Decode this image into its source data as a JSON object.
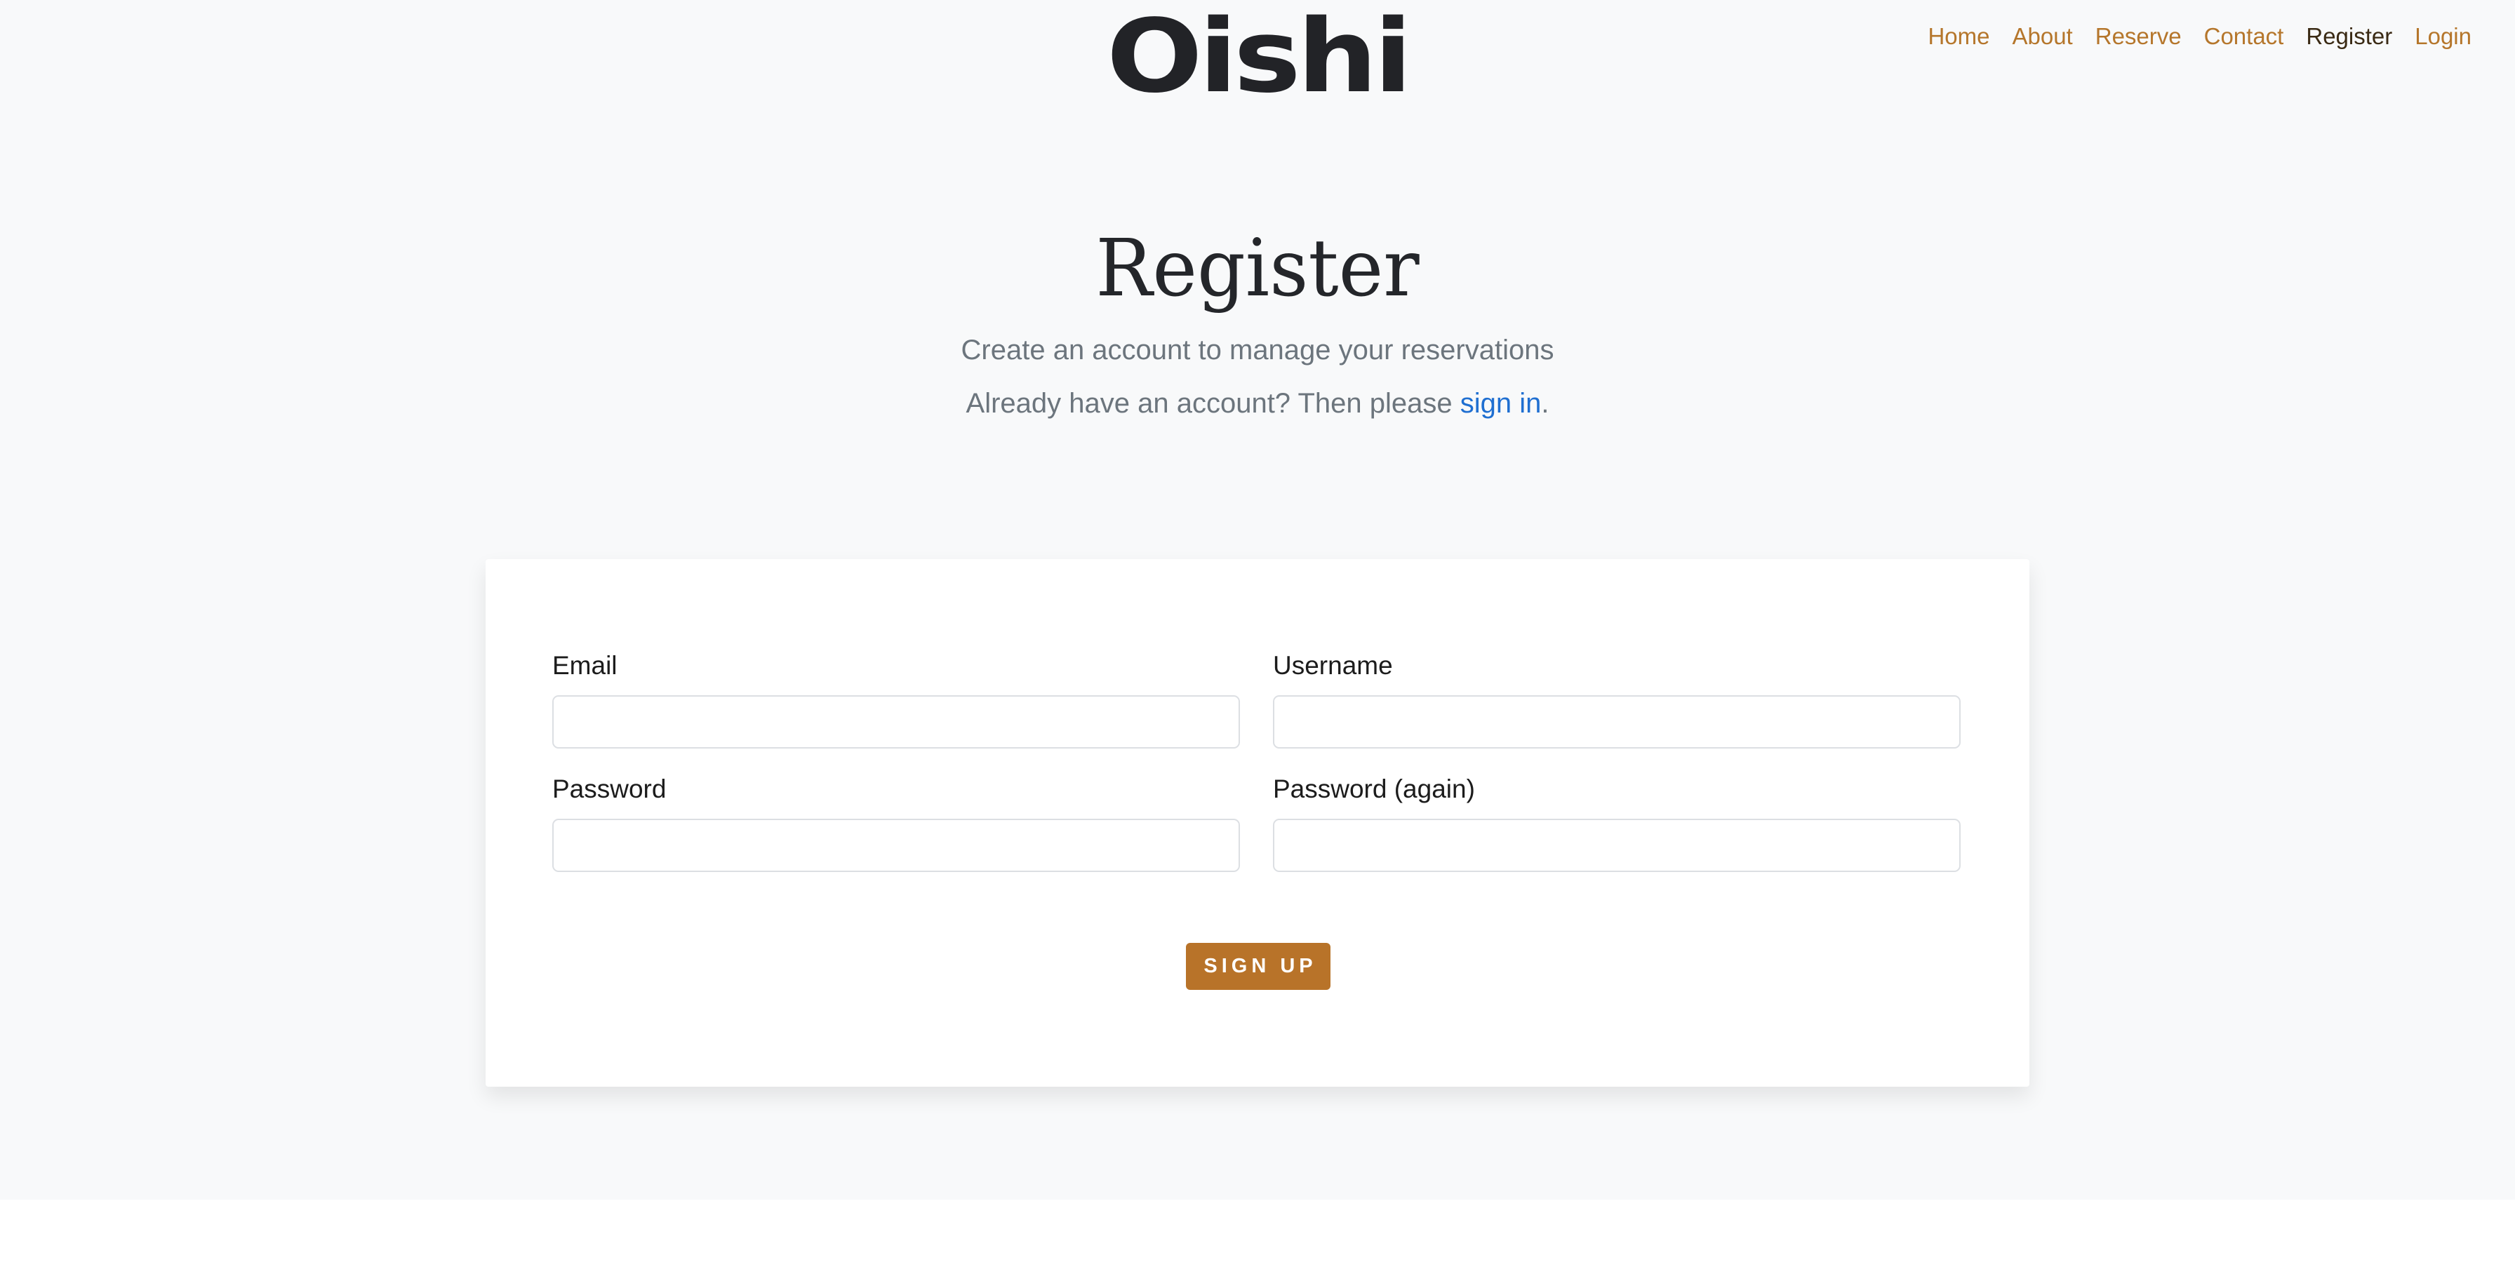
{
  "brand": {
    "logo_text": "Oishi"
  },
  "nav": {
    "items": [
      {
        "label": "Home"
      },
      {
        "label": "About"
      },
      {
        "label": "Reserve"
      },
      {
        "label": "Contact"
      },
      {
        "label": "Register"
      },
      {
        "label": "Login"
      }
    ],
    "active": "Register",
    "link_color": "#b5762b"
  },
  "header": {
    "title": "Register",
    "subtitle": "Create an account to manage your reservations",
    "signin_prefix": "Already have an account? Then please ",
    "signin_link": "sign in",
    "signin_suffix": "."
  },
  "form": {
    "fields": [
      {
        "label": "Email",
        "value": "",
        "placeholder": ""
      },
      {
        "label": "Username",
        "value": "",
        "placeholder": ""
      },
      {
        "label": "Password",
        "value": "",
        "placeholder": ""
      },
      {
        "label": "Password (again)",
        "value": "",
        "placeholder": ""
      }
    ],
    "submit_label": "SIGN UP"
  },
  "colors": {
    "page_background": "#f8f9fa",
    "button": "#b87329",
    "link": "#1f6fd1",
    "text_muted": "#6c757d"
  }
}
